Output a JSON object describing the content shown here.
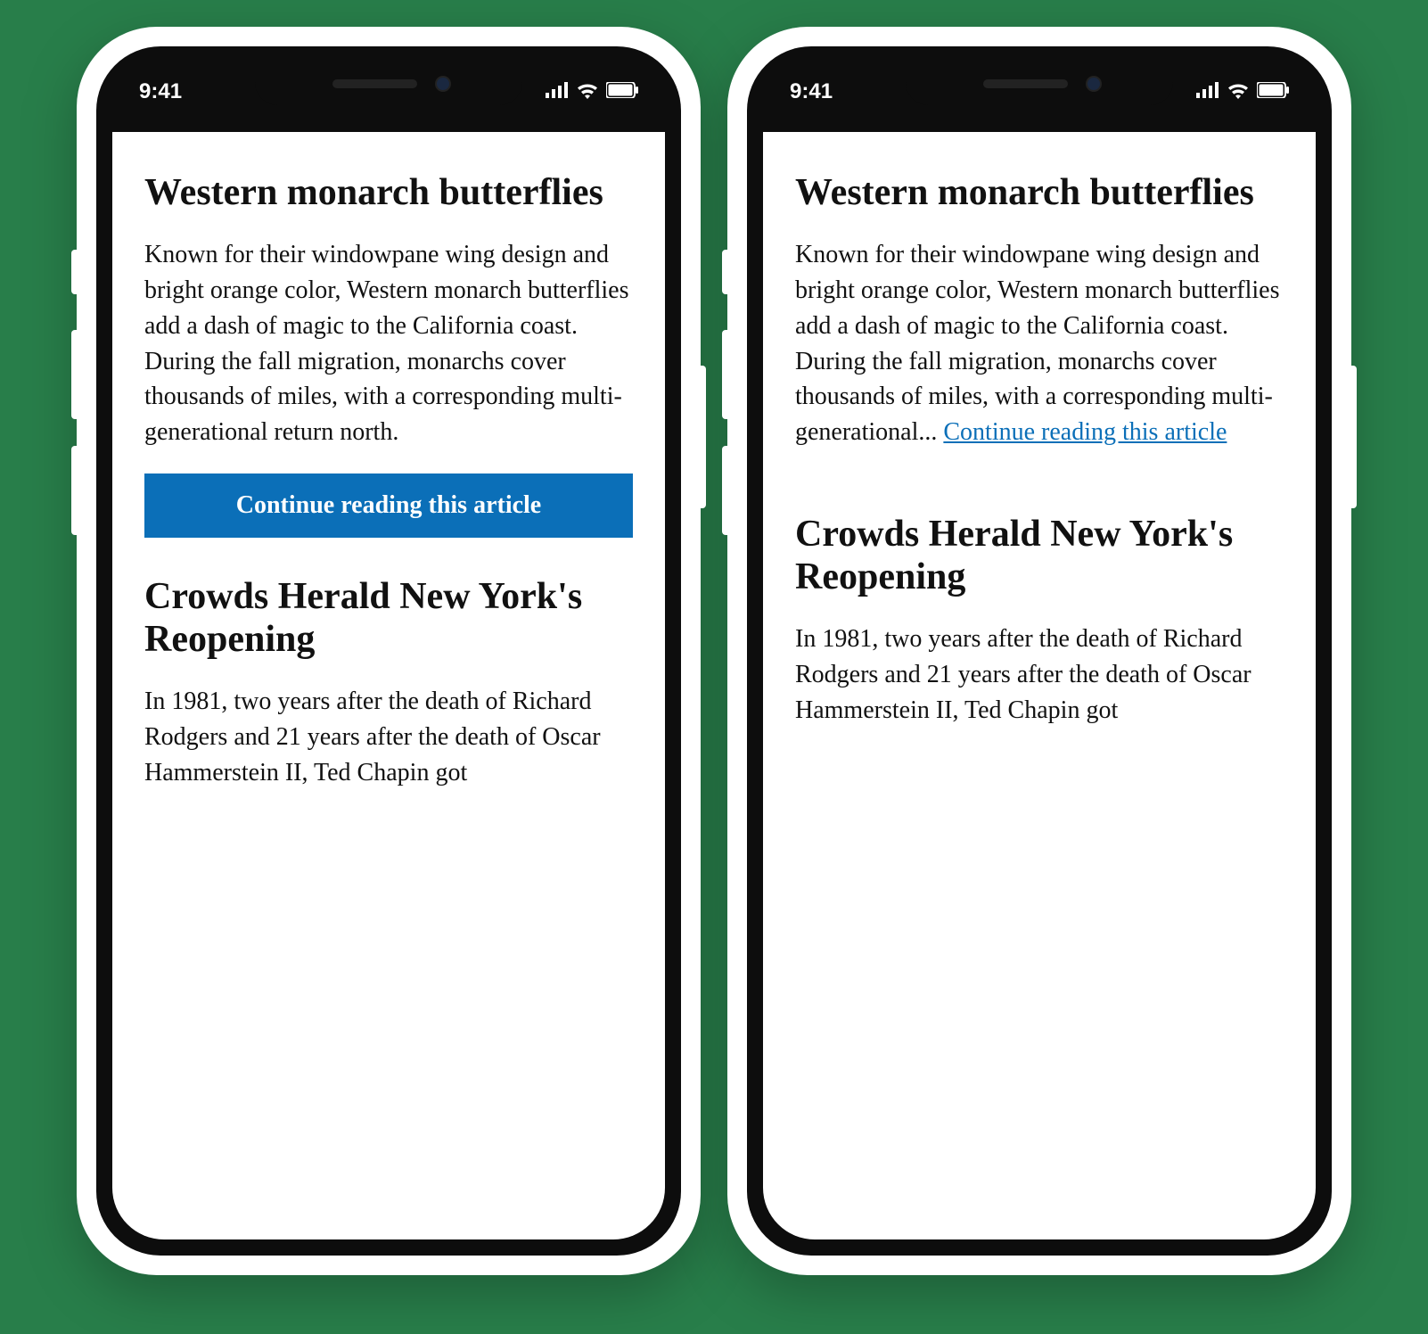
{
  "status": {
    "time": "9:41"
  },
  "phones": {
    "a": {
      "article1": {
        "title": "Western monarch butterflies",
        "body": "Known for their windowpane wing design and bright orange color, Western monarch butterflies add a dash of magic to the California coast. During the fall migration, monarchs cover thousands of miles, with a corresponding multi-generational return north.",
        "cta": "Continue reading this article"
      },
      "article2": {
        "title": "Crowds Herald New York's Reopening",
        "body": "In 1981, two years after the death of Richard Rodgers and 21 years after the death of Oscar Hammerstein II, Ted Chapin got"
      }
    },
    "b": {
      "article1": {
        "title": "Western monarch butterflies",
        "body_truncated": "Known for their windowpane wing design and bright orange color, Western monarch butterflies add a dash of magic to the California coast. During the fall migration, monarchs cover thousands of miles, with a corresponding multi-generational... ",
        "link": "Continue reading this article"
      },
      "article2": {
        "title": "Crowds Herald New York's Reopening",
        "body": "In 1981, two years after the death of Richard Rodgers and 21 years after the death of Oscar Hammerstein II, Ted Chapin got"
      }
    }
  }
}
